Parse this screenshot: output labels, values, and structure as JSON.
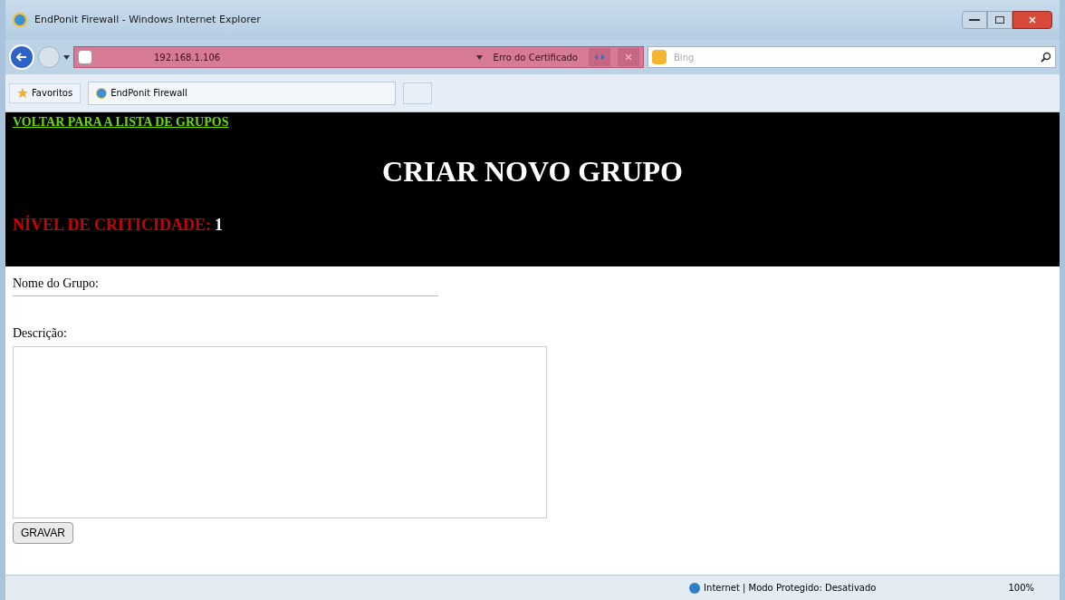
{
  "window": {
    "title": "EndPonit Firewall - Windows Internet Explorer"
  },
  "address_bar": {
    "url": "192.168.1.106",
    "certificate_error": "Erro do Certificado"
  },
  "search": {
    "placeholder": "Bing"
  },
  "favorites": {
    "label": "Favoritos"
  },
  "tabs": [
    {
      "label": "EndPonit Firewall",
      "selected": true
    }
  ],
  "header": {
    "back_link": "VOLTAR PARA A LISTA DE GRUPOS",
    "title": "CRIAR NOVO GRUPO",
    "criticality_label": "NÍVEL DE CRITICIDADE:",
    "criticality_value": "1"
  },
  "form": {
    "name_label": "Nome do Grupo:",
    "description_label": "Descrição:",
    "submit": "GRAVAR"
  },
  "status_bar": {
    "zone": "Internet | Modo Protegido: Desativado",
    "zoom": "100%"
  }
}
